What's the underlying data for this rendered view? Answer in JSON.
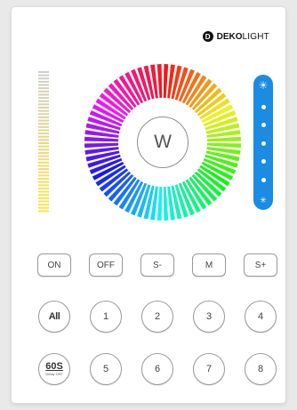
{
  "brand": {
    "icon": "D",
    "bold": "DEKO",
    "light": "LIGHT"
  },
  "wheel": {
    "center_label": "W",
    "icon": "color-wheel"
  },
  "colors": {
    "brightness_bar": "#1c8be2",
    "panel": "#ffffff",
    "background": "#e9e9e9"
  },
  "brightness": {
    "top_icon": "☀",
    "bottom_icon": "✳",
    "dots": 5
  },
  "row1": [
    {
      "label": "ON",
      "name": "on-button"
    },
    {
      "label": "OFF",
      "name": "off-button"
    },
    {
      "label": "S-",
      "name": "speed-down-button"
    },
    {
      "label": "M",
      "name": "mode-button"
    },
    {
      "label": "S+",
      "name": "speed-up-button"
    }
  ],
  "row2": [
    {
      "label": "All",
      "name": "all-zones-button"
    },
    {
      "label": "1",
      "name": "zone-1-button"
    },
    {
      "label": "2",
      "name": "zone-2-button"
    },
    {
      "label": "3",
      "name": "zone-3-button"
    },
    {
      "label": "4",
      "name": "zone-4-button"
    }
  ],
  "row3": [
    {
      "label": "5",
      "name": "zone-5-button"
    },
    {
      "label": "6",
      "name": "zone-6-button"
    },
    {
      "label": "7",
      "name": "zone-7-button"
    },
    {
      "label": "8",
      "name": "zone-8-button"
    }
  ],
  "timer": {
    "label": "60S",
    "sub": "Delay OFF"
  }
}
